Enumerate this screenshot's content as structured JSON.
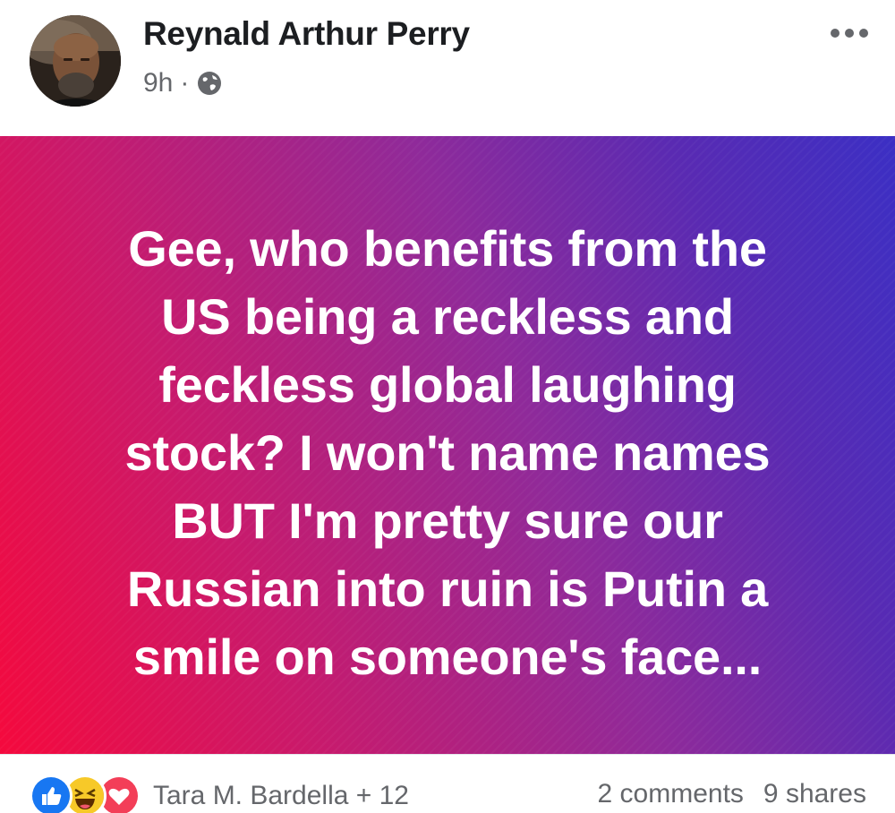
{
  "post": {
    "author": {
      "name": "Reynald Arthur Perry",
      "time": "9h",
      "separator": "·",
      "audience_icon": "globe-icon"
    },
    "menu_icon": "more-horizontal-icon",
    "text": "Gee, who benefits from the\nUS being a reckless and\nfeckless global laughing\nstock? I won't name names\nBUT I'm pretty sure our\nRussian into ruin is Putin a\nsmile on someone's face...",
    "background_colors": [
      "#f5093d",
      "#8f2a9a",
      "#3b2fc4"
    ],
    "reactions": {
      "icons": [
        "like-icon",
        "haha-icon",
        "love-icon"
      ],
      "reactors": "Tara M. Bardella + 12"
    },
    "comments": "2 comments",
    "shares": "9 shares"
  }
}
